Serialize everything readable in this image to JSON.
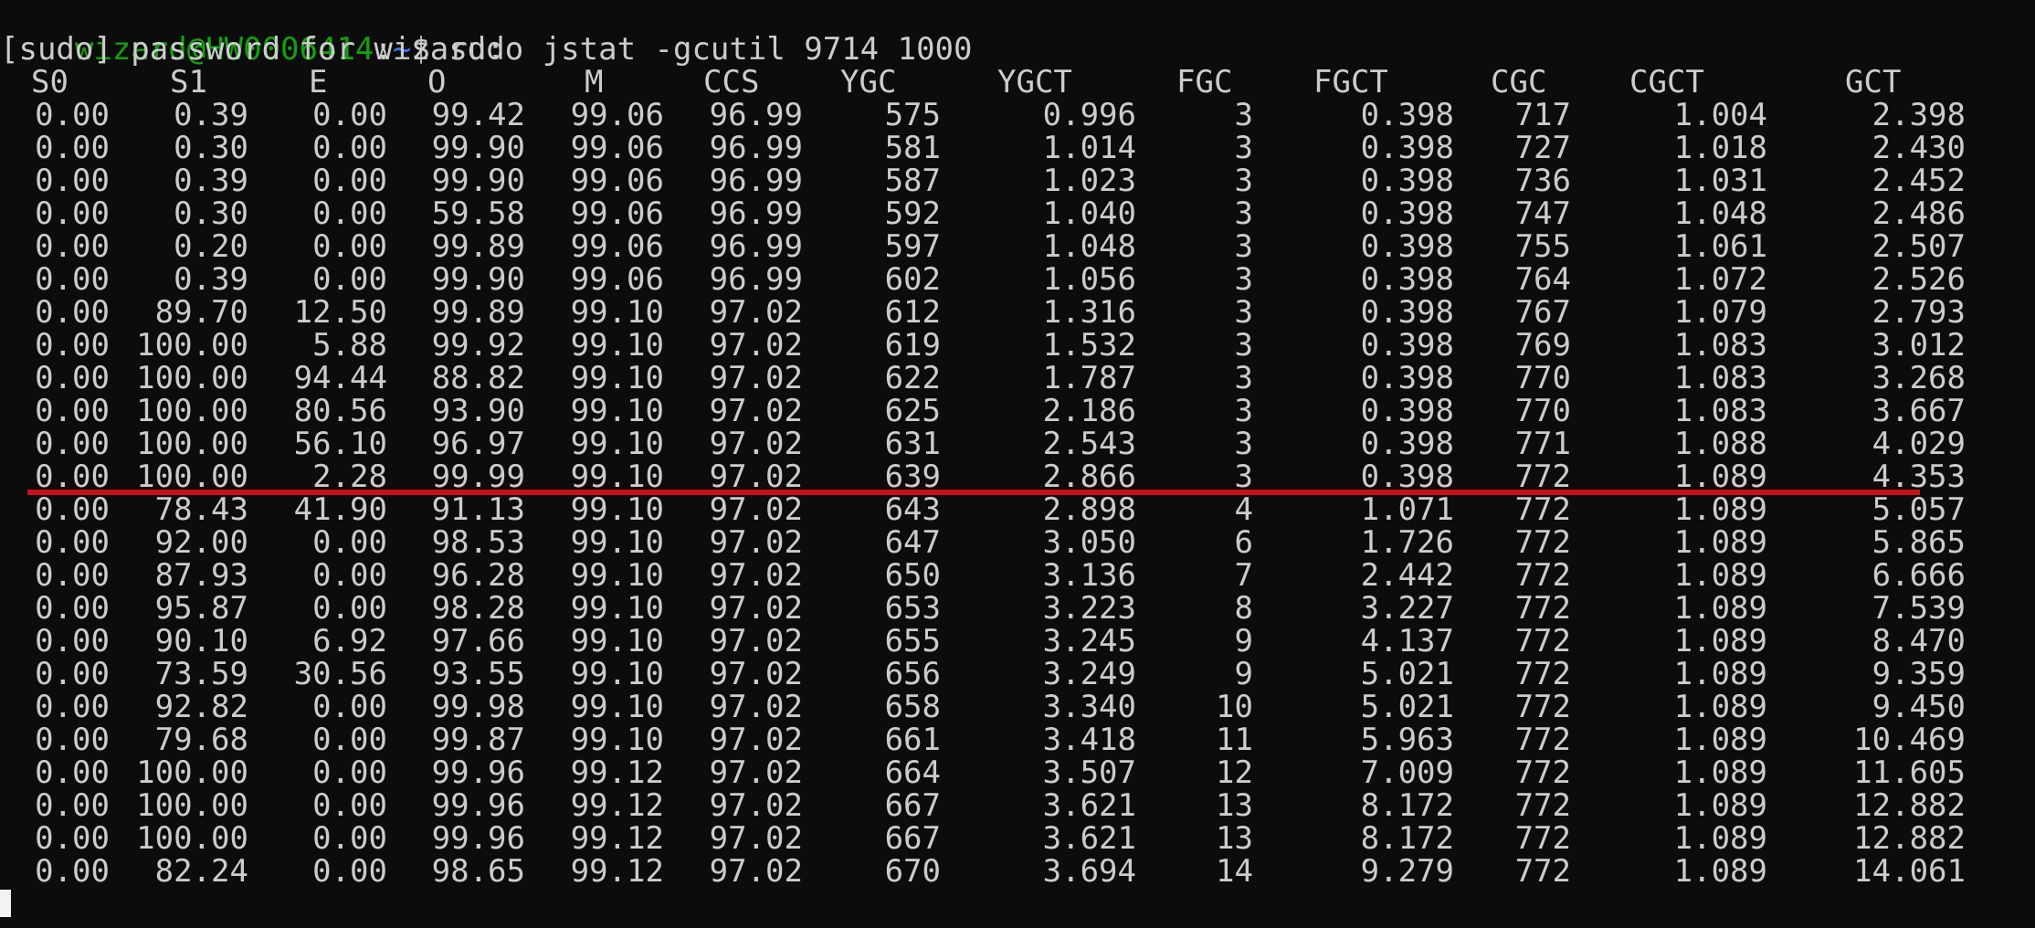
{
  "prompt": {
    "user_host": "wizard@HW0006414",
    "colon": ":",
    "path": "~",
    "symbol": "$",
    "command": "sudo jstat -gcutil 9714 1000"
  },
  "sudo_line": "[sudo] password for wizard:",
  "headers": [
    "S0",
    "S1",
    "E",
    "O",
    "M",
    "CCS",
    "YGC",
    "YGCT",
    "FGC",
    "FGCT",
    "CGC",
    "CGCT",
    "GCT"
  ],
  "rows": [
    [
      "0.00",
      "0.39",
      "0.00",
      "99.42",
      "99.06",
      "96.99",
      "575",
      "0.996",
      "3",
      "0.398",
      "717",
      "1.004",
      "2.398"
    ],
    [
      "0.00",
      "0.30",
      "0.00",
      "99.90",
      "99.06",
      "96.99",
      "581",
      "1.014",
      "3",
      "0.398",
      "727",
      "1.018",
      "2.430"
    ],
    [
      "0.00",
      "0.39",
      "0.00",
      "99.90",
      "99.06",
      "96.99",
      "587",
      "1.023",
      "3",
      "0.398",
      "736",
      "1.031",
      "2.452"
    ],
    [
      "0.00",
      "0.30",
      "0.00",
      "59.58",
      "99.06",
      "96.99",
      "592",
      "1.040",
      "3",
      "0.398",
      "747",
      "1.048",
      "2.486"
    ],
    [
      "0.00",
      "0.20",
      "0.00",
      "99.89",
      "99.06",
      "96.99",
      "597",
      "1.048",
      "3",
      "0.398",
      "755",
      "1.061",
      "2.507"
    ],
    [
      "0.00",
      "0.39",
      "0.00",
      "99.90",
      "99.06",
      "96.99",
      "602",
      "1.056",
      "3",
      "0.398",
      "764",
      "1.072",
      "2.526"
    ],
    [
      "0.00",
      "89.70",
      "12.50",
      "99.89",
      "99.10",
      "97.02",
      "612",
      "1.316",
      "3",
      "0.398",
      "767",
      "1.079",
      "2.793"
    ],
    [
      "0.00",
      "100.00",
      "5.88",
      "99.92",
      "99.10",
      "97.02",
      "619",
      "1.532",
      "3",
      "0.398",
      "769",
      "1.083",
      "3.012"
    ],
    [
      "0.00",
      "100.00",
      "94.44",
      "88.82",
      "99.10",
      "97.02",
      "622",
      "1.787",
      "3",
      "0.398",
      "770",
      "1.083",
      "3.268"
    ],
    [
      "0.00",
      "100.00",
      "80.56",
      "93.90",
      "99.10",
      "97.02",
      "625",
      "2.186",
      "3",
      "0.398",
      "770",
      "1.083",
      "3.667"
    ],
    [
      "0.00",
      "100.00",
      "56.10",
      "96.97",
      "99.10",
      "97.02",
      "631",
      "2.543",
      "3",
      "0.398",
      "771",
      "1.088",
      "4.029"
    ],
    [
      "0.00",
      "100.00",
      "2.28",
      "99.99",
      "99.10",
      "97.02",
      "639",
      "2.866",
      "3",
      "0.398",
      "772",
      "1.089",
      "4.353"
    ],
    [
      "0.00",
      "78.43",
      "41.90",
      "91.13",
      "99.10",
      "97.02",
      "643",
      "2.898",
      "4",
      "1.071",
      "772",
      "1.089",
      "5.057"
    ],
    [
      "0.00",
      "92.00",
      "0.00",
      "98.53",
      "99.10",
      "97.02",
      "647",
      "3.050",
      "6",
      "1.726",
      "772",
      "1.089",
      "5.865"
    ],
    [
      "0.00",
      "87.93",
      "0.00",
      "96.28",
      "99.10",
      "97.02",
      "650",
      "3.136",
      "7",
      "2.442",
      "772",
      "1.089",
      "6.666"
    ],
    [
      "0.00",
      "95.87",
      "0.00",
      "98.28",
      "99.10",
      "97.02",
      "653",
      "3.223",
      "8",
      "3.227",
      "772",
      "1.089",
      "7.539"
    ],
    [
      "0.00",
      "90.10",
      "6.92",
      "97.66",
      "99.10",
      "97.02",
      "655",
      "3.245",
      "9",
      "4.137",
      "772",
      "1.089",
      "8.470"
    ],
    [
      "0.00",
      "73.59",
      "30.56",
      "93.55",
      "99.10",
      "97.02",
      "656",
      "3.249",
      "9",
      "5.021",
      "772",
      "1.089",
      "9.359"
    ],
    [
      "0.00",
      "92.82",
      "0.00",
      "99.98",
      "99.10",
      "97.02",
      "658",
      "3.340",
      "10",
      "5.021",
      "772",
      "1.089",
      "9.450"
    ],
    [
      "0.00",
      "79.68",
      "0.00",
      "99.87",
      "99.10",
      "97.02",
      "661",
      "3.418",
      "11",
      "5.963",
      "772",
      "1.089",
      "10.469"
    ],
    [
      "0.00",
      "100.00",
      "0.00",
      "99.96",
      "99.12",
      "97.02",
      "664",
      "3.507",
      "12",
      "7.009",
      "772",
      "1.089",
      "11.605"
    ],
    [
      "0.00",
      "100.00",
      "0.00",
      "99.96",
      "99.12",
      "97.02",
      "667",
      "3.621",
      "13",
      "8.172",
      "772",
      "1.089",
      "12.882"
    ],
    [
      "0.00",
      "100.00",
      "0.00",
      "99.96",
      "99.12",
      "97.02",
      "667",
      "3.621",
      "13",
      "8.172",
      "772",
      "1.089",
      "12.882"
    ],
    [
      "0.00",
      "82.24",
      "0.00",
      "98.65",
      "99.12",
      "97.02",
      "670",
      "3.694",
      "14",
      "9.279",
      "772",
      "1.089",
      "14.061"
    ]
  ],
  "colors": {
    "background": "#0c0c0c",
    "text": "#cccccc",
    "prompt_user": "#13a10e",
    "prompt_path": "#3b78ff",
    "annotation_line": "#c8101c"
  }
}
